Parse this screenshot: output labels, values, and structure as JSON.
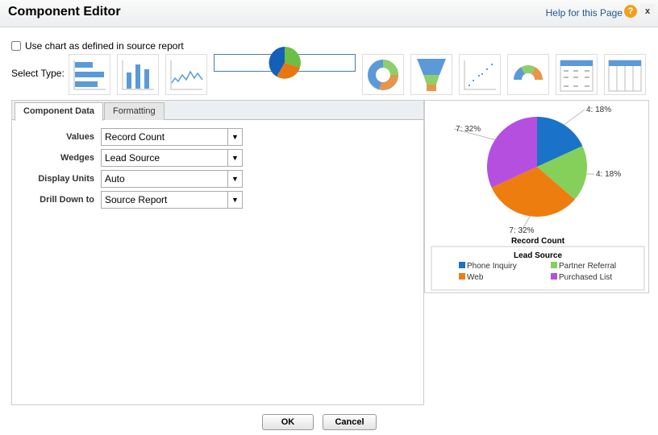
{
  "header": {
    "title": "Component Editor",
    "help": "Help for this Page",
    "help_icon": "?",
    "close": "x"
  },
  "use_source": {
    "label": "Use chart as defined in source report",
    "checked": false
  },
  "select_type_label": "Select Type:",
  "types": [
    "horizontal-bar",
    "vertical-bar",
    "line",
    "pie",
    "donut",
    "funnel",
    "scatter",
    "gauge",
    "table",
    "metric-table"
  ],
  "selected_type": "pie",
  "tabs": [
    {
      "label": "Component Data",
      "active": true
    },
    {
      "label": "Formatting",
      "active": false
    }
  ],
  "fields": [
    {
      "label": "Values",
      "value": "Record Count"
    },
    {
      "label": "Wedges",
      "value": "Lead Source"
    },
    {
      "label": "Display Units",
      "value": "Auto"
    },
    {
      "label": "Drill Down to",
      "value": "Source Report"
    }
  ],
  "buttons": {
    "ok": "OK",
    "cancel": "Cancel"
  },
  "chart_data": {
    "type": "pie",
    "title": "Record Count",
    "legend_title": "Lead Source",
    "legend_position": "bottom",
    "slices": [
      {
        "name": "Phone Inquiry",
        "value": 4,
        "percent": 18,
        "label": "4: 18%",
        "color": "#1a73c9"
      },
      {
        "name": "Partner Referral",
        "value": 4,
        "percent": 18,
        "label": "4: 18%",
        "color": "#85d05a"
      },
      {
        "name": "Web",
        "value": 7,
        "percent": 32,
        "label": "7: 32%",
        "color": "#ee7d10"
      },
      {
        "name": "Purchased List",
        "value": 7,
        "percent": 32,
        "label": "7: 32%",
        "color": "#b54fe0"
      }
    ]
  }
}
